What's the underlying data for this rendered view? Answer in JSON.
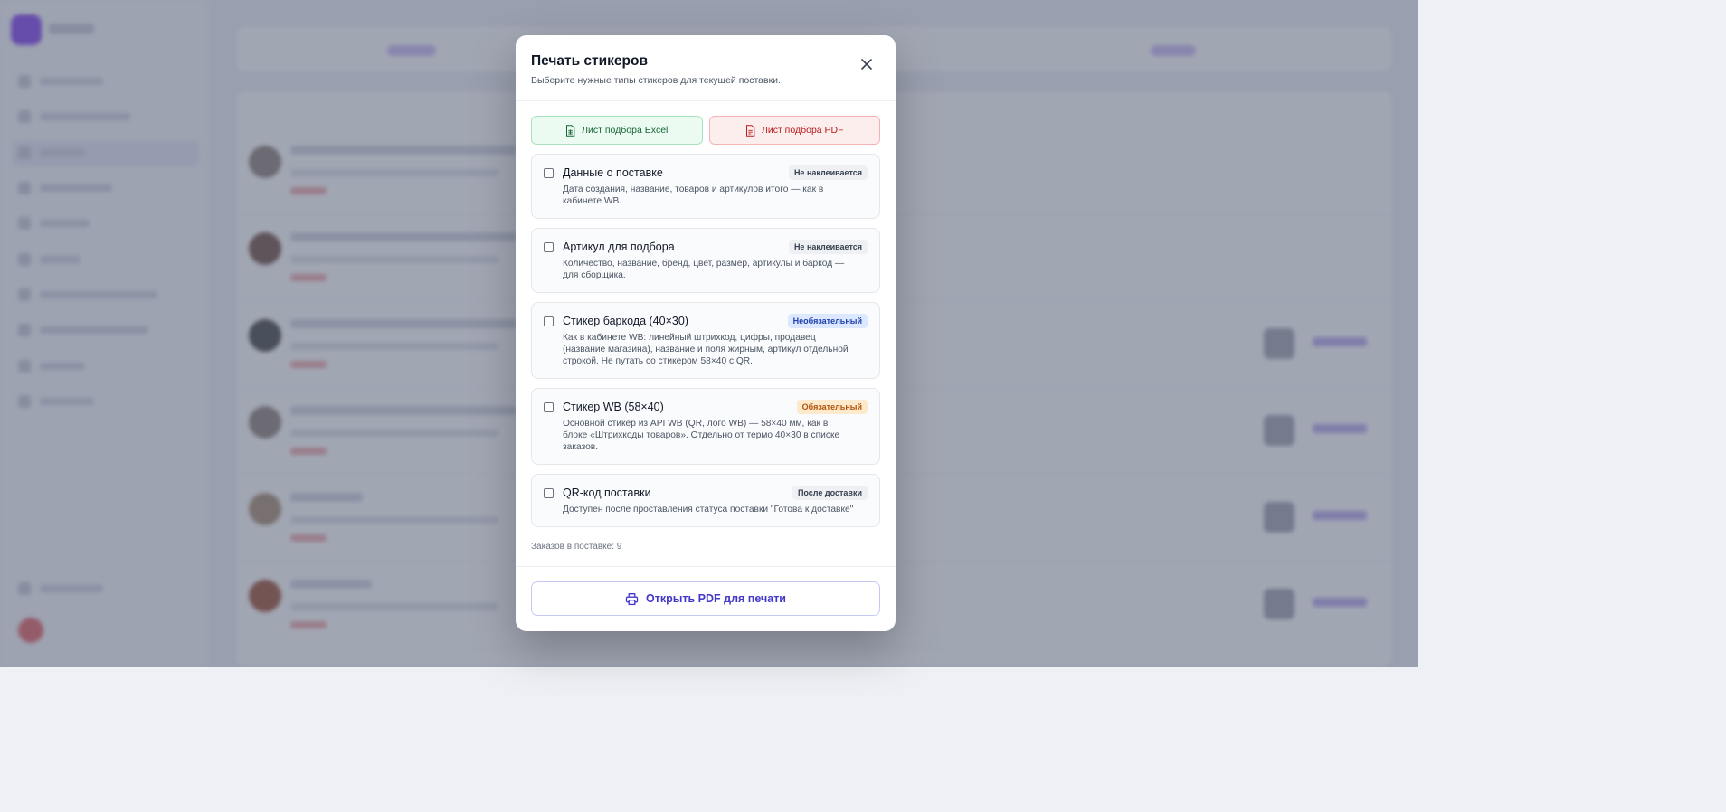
{
  "modal": {
    "title": "Печать стикеров",
    "subtitle": "Выберите нужные типы стикеров для текущей поставки.",
    "excel_button": "Лист подбора Excel",
    "pdf_button": "Лист подбора PDF",
    "options": [
      {
        "title": "Данные о поставке",
        "badge": "Не наклеивается",
        "badge_type": "gray",
        "description": "Дата создания, название, товаров и артикулов итого — как в кабинете WB.",
        "checked": false
      },
      {
        "title": "Артикул для подбора",
        "badge": "Не наклеивается",
        "badge_type": "gray",
        "description": "Количество, название, бренд, цвет, размер, артикулы и баркод — для сборщика.",
        "checked": false
      },
      {
        "title": "Стикер баркода (40×30)",
        "badge": "Необязательный",
        "badge_type": "blue",
        "description": "Как в кабинете WB: линейный штрихкод, цифры, продавец (название магазина), название и поля жирным, артикул отдельной строкой. Не путать со стикером 58×40 с QR.",
        "checked": false
      },
      {
        "title": "Стикер WB (58×40)",
        "badge": "Обязательный",
        "badge_type": "orange",
        "description": "Основной стикер из API WB (QR, лого WB) — 58×40 мм, как в блоке «Штрихкоды товаров». Отдельно от термо 40×30 в списке заказов.",
        "checked": false
      },
      {
        "title": "QR-код поставки",
        "badge": "После доставки",
        "badge_type": "gray",
        "description": "Доступен после проставления статуса поставки \"Готова к доставке\"",
        "checked": false
      }
    ],
    "orders_count": "Заказов в поставке: 9",
    "print_button": "Открыть PDF для печати"
  },
  "colors": {
    "accent": "#4338ca",
    "excel": "#166534",
    "pdf": "#b91c1c",
    "overlay": "#545c74"
  },
  "icons": {
    "close": "close-icon",
    "excel": "file-spreadsheet-icon",
    "pdf": "file-pdf-icon",
    "print": "printer-icon"
  }
}
